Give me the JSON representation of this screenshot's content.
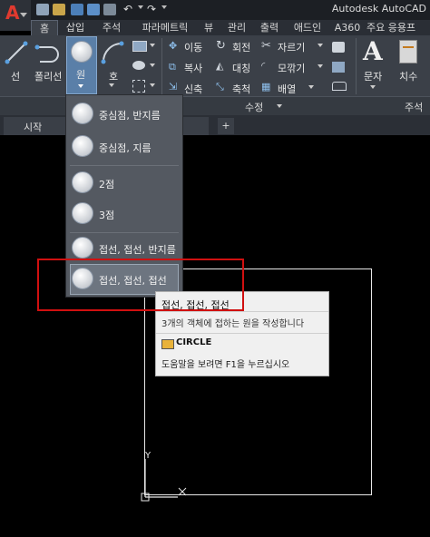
{
  "title_bar": {
    "title": "Autodesk AutoCAD"
  },
  "ribbon_tabs": [
    "홈",
    "삽입",
    "주석",
    "파라메트릭",
    "뷰",
    "관리",
    "출력",
    "애드인",
    "A360",
    "주요 응용프"
  ],
  "draw_panel": {
    "line": "선",
    "polyline": "폴리선",
    "circle": "원",
    "arc": "호"
  },
  "modify_panel": {
    "label": "수정",
    "move": "이동",
    "rotate": "회전",
    "trim": "자르기",
    "copy": "복사",
    "mirror": "대칭",
    "fillet": "모깎기",
    "stretch": "신축",
    "scale": "축척",
    "array": "배열"
  },
  "annotation_panel": {
    "label": "주석",
    "text": "문자",
    "dimension": "치수"
  },
  "doc_tabs": {
    "start": "시작",
    "add": "+"
  },
  "circle_menu": [
    "중심점, 반지름",
    "중심점, 지름",
    "2점",
    "3점",
    "접선, 접선, 반지름",
    "접선, 접선, 접선"
  ],
  "tooltip": {
    "title": "접선, 접선, 접선",
    "description": "3개의 객체에 접하는 원을 작성합니다",
    "command": "CIRCLE",
    "help": "도움말을 보려면 F1을 누르십시오"
  },
  "ucs": {
    "x": "X",
    "y": "Y"
  },
  "colors": {
    "highlight": "#d01010",
    "ribbon": "#3b4048",
    "accent": "#1e7bd1"
  }
}
